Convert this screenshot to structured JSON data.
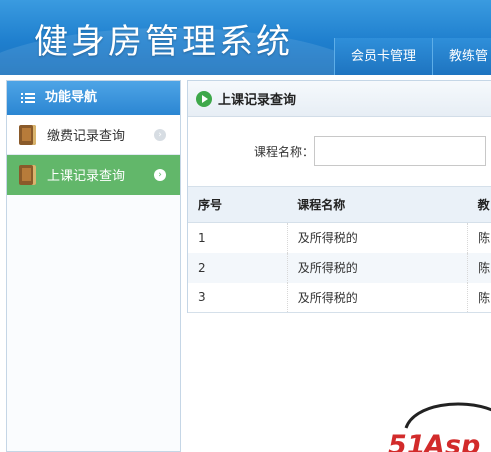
{
  "header": {
    "title": "健身房管理系统",
    "nav_tabs": [
      "会员卡管理",
      "教练管"
    ]
  },
  "sidebar": {
    "heading": "功能导航",
    "items": [
      {
        "label": "缴费记录查询",
        "active": false
      },
      {
        "label": "上课记录查询",
        "active": true
      }
    ]
  },
  "main": {
    "title": "上课记录查询",
    "search": {
      "label": "课程名称：",
      "value": "",
      "placeholder": ""
    },
    "table": {
      "columns": [
        "序号",
        "课程名称",
        "教"
      ],
      "rows": [
        [
          "1",
          "及所得税的",
          "陈"
        ],
        [
          "2",
          "及所得税的",
          "陈"
        ],
        [
          "3",
          "及所得税的",
          "陈"
        ]
      ]
    }
  },
  "watermark": {
    "text": "51Asp"
  },
  "colors": {
    "header_blue": "#2284d2",
    "active_green": "#62b76a",
    "icon_green": "#3ea84a",
    "logo_red": "#d22b2b"
  }
}
